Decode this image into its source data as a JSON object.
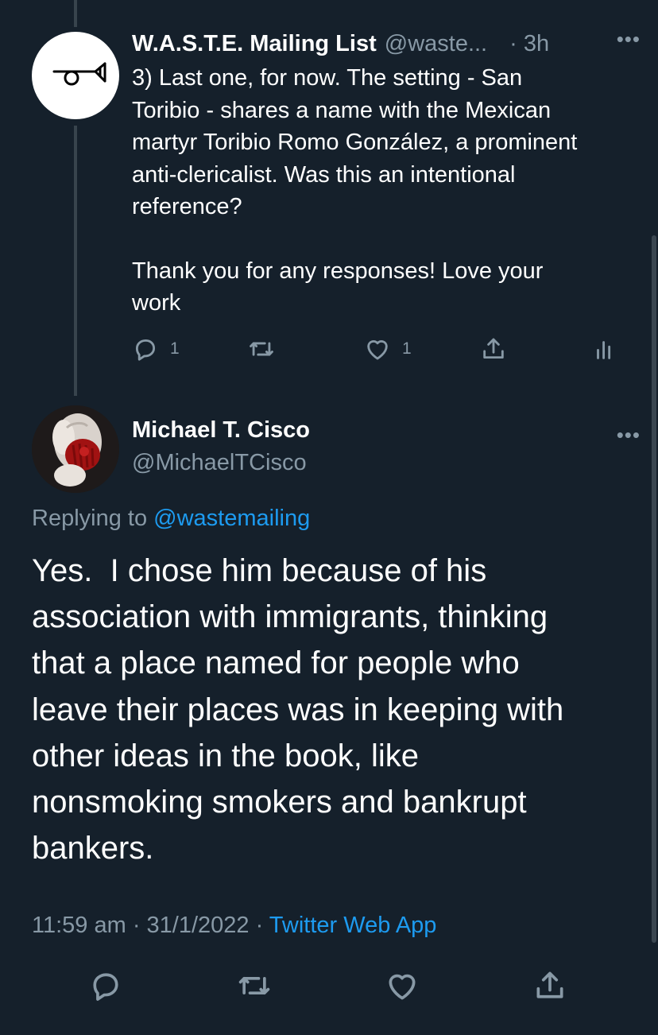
{
  "tweet1": {
    "name": "W.A.S.T.E. Mailing List",
    "handle": "@waste...",
    "time": "· 3h",
    "more": "•••",
    "body_lines_p1": [
      "3) Last one, for now. The setting - San",
      "Toribio - shares a name with the Mexican",
      "martyr Toribio Romo González, a prominent",
      "anti-clericalist. Was this an intentional",
      "reference?"
    ],
    "body_lines_p2": [
      "Thank you for any responses! Love your",
      "work"
    ],
    "reply_count": "1",
    "like_count": "1"
  },
  "tweet2": {
    "name": "Michael T. Cisco",
    "handle": "@MichaelTCisco",
    "more": "•••",
    "replying_prefix": "Replying to ",
    "replying_mention": "@wastemailing",
    "text": "Yes.  I chose him because of his\nassociation with immigrants, thinking\nthat a place named for people who\nleave their places was in keeping with\nother ideas in the book, like\nnonsmoking smokers and bankrupt\nbankers.",
    "timestamp": "11:59 am · 31/1/2022 · ",
    "source": "Twitter Web App"
  },
  "icons": {
    "reply": "reply-icon",
    "retweet": "retweet-icon",
    "like": "heart-icon",
    "share": "share-icon",
    "analytics": "analytics-icon",
    "avatar1": "horn-logo-icon"
  },
  "colors": {
    "background": "#15202b",
    "text": "#ffffff",
    "muted": "#8899a6",
    "link": "#1d9bf0",
    "thread_line": "#38444d"
  }
}
